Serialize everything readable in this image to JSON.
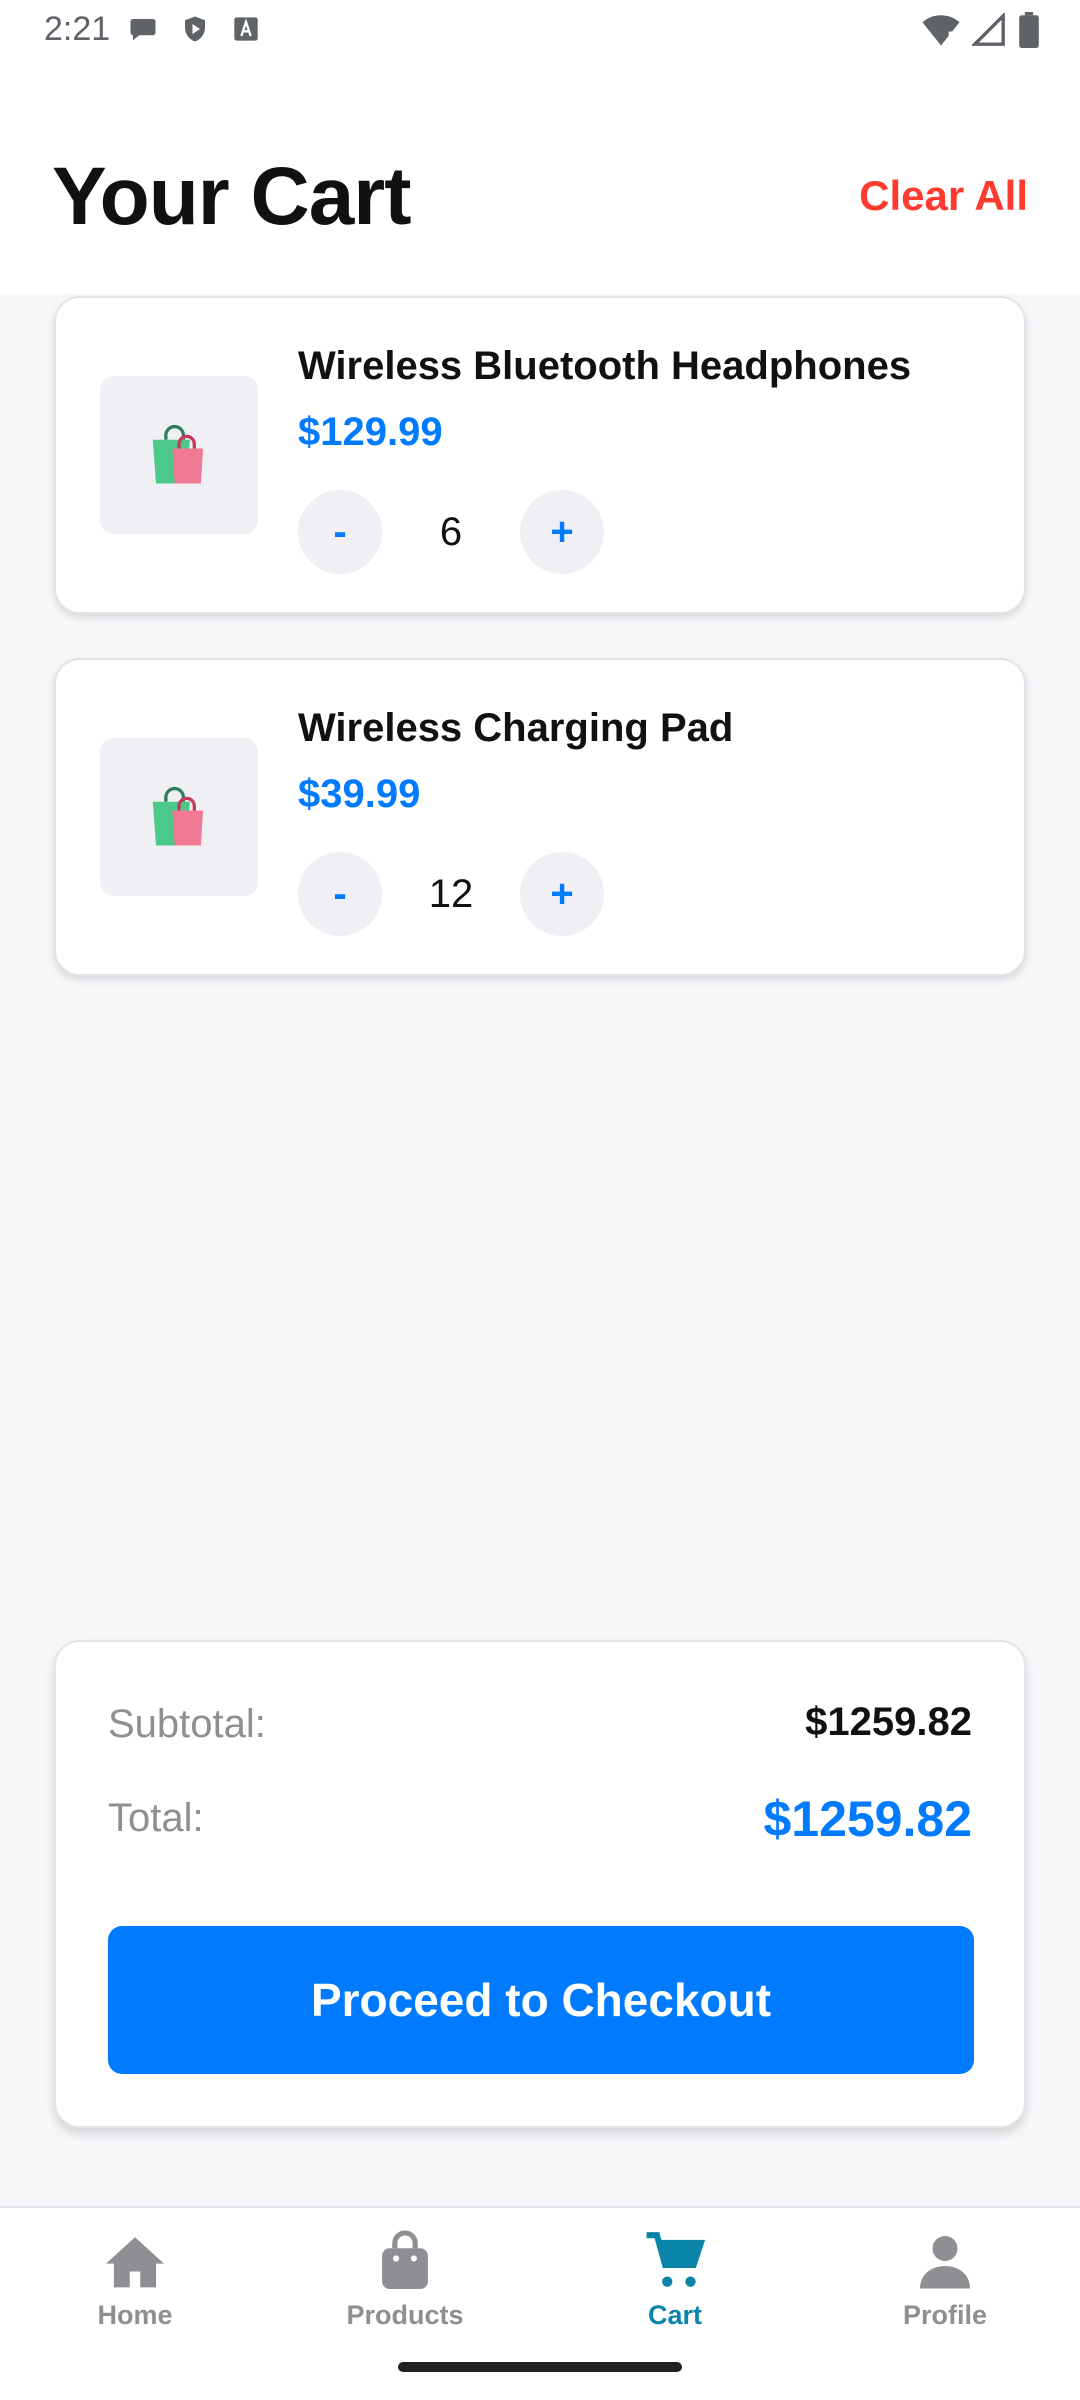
{
  "status_bar": {
    "time": "2:21"
  },
  "header": {
    "title": "Your Cart",
    "clear_label": "Clear All"
  },
  "cart_items": [
    {
      "name": "Wireless Bluetooth Headphones",
      "price": "$129.99",
      "quantity": "6",
      "minus": "-",
      "plus": "+",
      "image_icon": "shopping-bags-icon"
    },
    {
      "name": "Wireless Charging Pad",
      "price": "$39.99",
      "quantity": "12",
      "minus": "-",
      "plus": "+",
      "image_icon": "shopping-bags-icon"
    }
  ],
  "summary": {
    "subtotal_label": "Subtotal:",
    "subtotal_value": "$1259.82",
    "total_label": "Total:",
    "total_value": "$1259.82",
    "checkout_label": "Proceed to Checkout"
  },
  "bottom_nav": {
    "items": [
      {
        "label": "Home",
        "icon": "home-icon"
      },
      {
        "label": "Products",
        "icon": "bag-icon"
      },
      {
        "label": "Cart",
        "icon": "cart-icon",
        "active": true
      },
      {
        "label": "Profile",
        "icon": "person-icon"
      }
    ]
  },
  "colors": {
    "accent": "#007aff",
    "danger": "#ff3b30",
    "nav_active": "#0a84a8",
    "muted": "#8e8e93"
  }
}
